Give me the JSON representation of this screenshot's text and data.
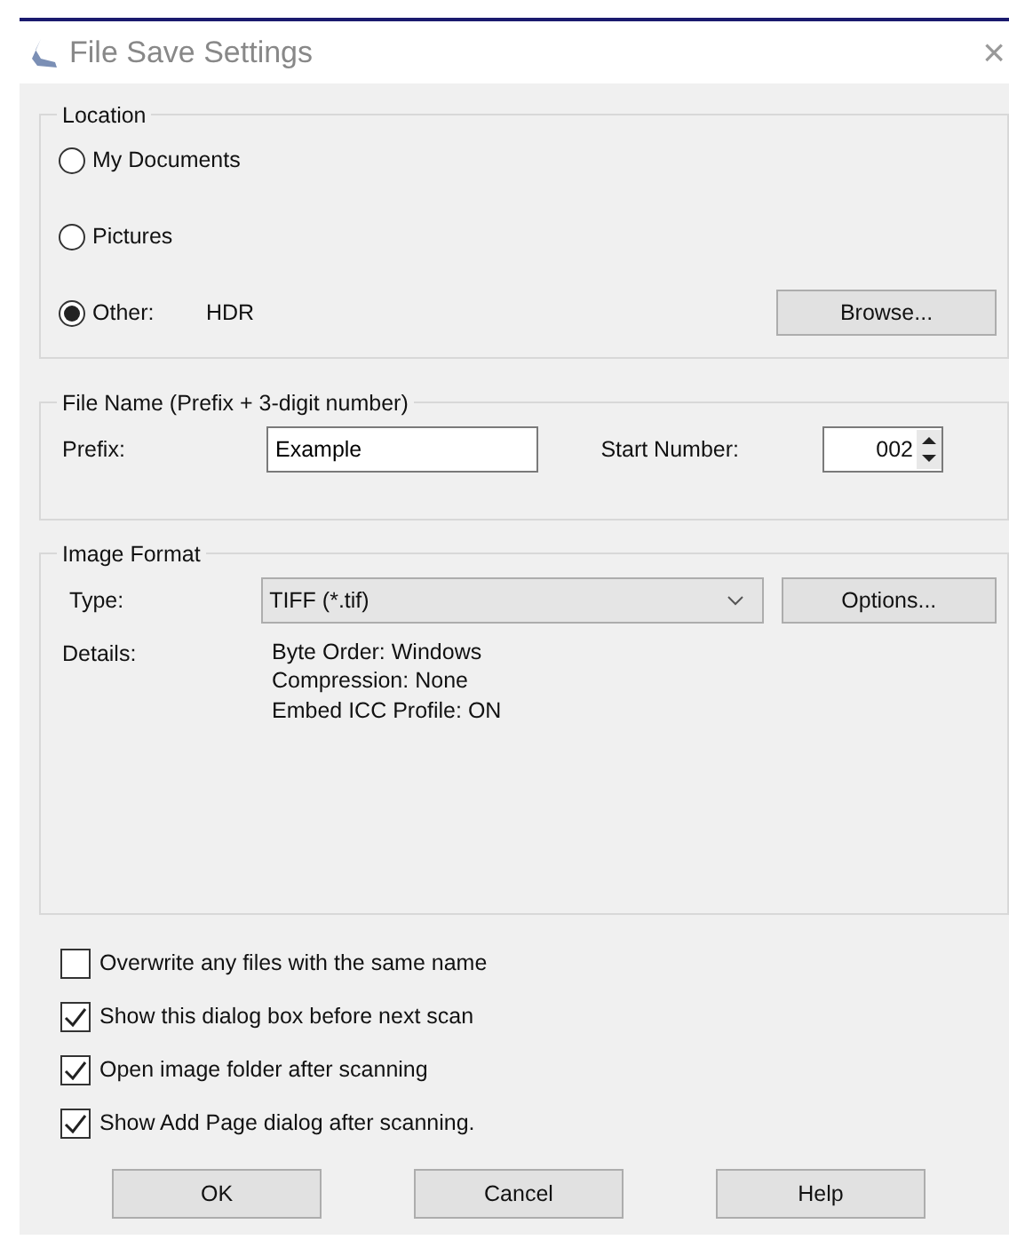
{
  "window": {
    "title": "File Save Settings",
    "close": "×"
  },
  "location": {
    "title": "Location",
    "options": [
      {
        "label": "My Documents",
        "selected": false
      },
      {
        "label": "Pictures",
        "selected": false
      },
      {
        "label": "Other:",
        "selected": true,
        "value": "HDR"
      }
    ],
    "browse": "Browse..."
  },
  "file_name": {
    "title": "File Name (Prefix + 3-digit number)",
    "prefix_label": "Prefix:",
    "prefix": "Example",
    "start_label": "Start Number:",
    "start": "002"
  },
  "image_format": {
    "title": "Image Format",
    "type_label": "Type:",
    "type": "TIFF (*.tif)",
    "options": "Options...",
    "details_label": "Details:",
    "details": [
      "Byte Order: Windows",
      "Compression: None",
      "Embed ICC Profile: ON"
    ]
  },
  "checkboxes": [
    {
      "label": "Overwrite any files with the same name",
      "checked": false
    },
    {
      "label": "Show this dialog box before next scan",
      "checked": true
    },
    {
      "label": "Open image folder after scanning",
      "checked": true
    },
    {
      "label": "Show Add Page dialog after scanning.",
      "checked": true
    }
  ],
  "buttons": [
    "OK",
    "Cancel",
    "Help"
  ]
}
